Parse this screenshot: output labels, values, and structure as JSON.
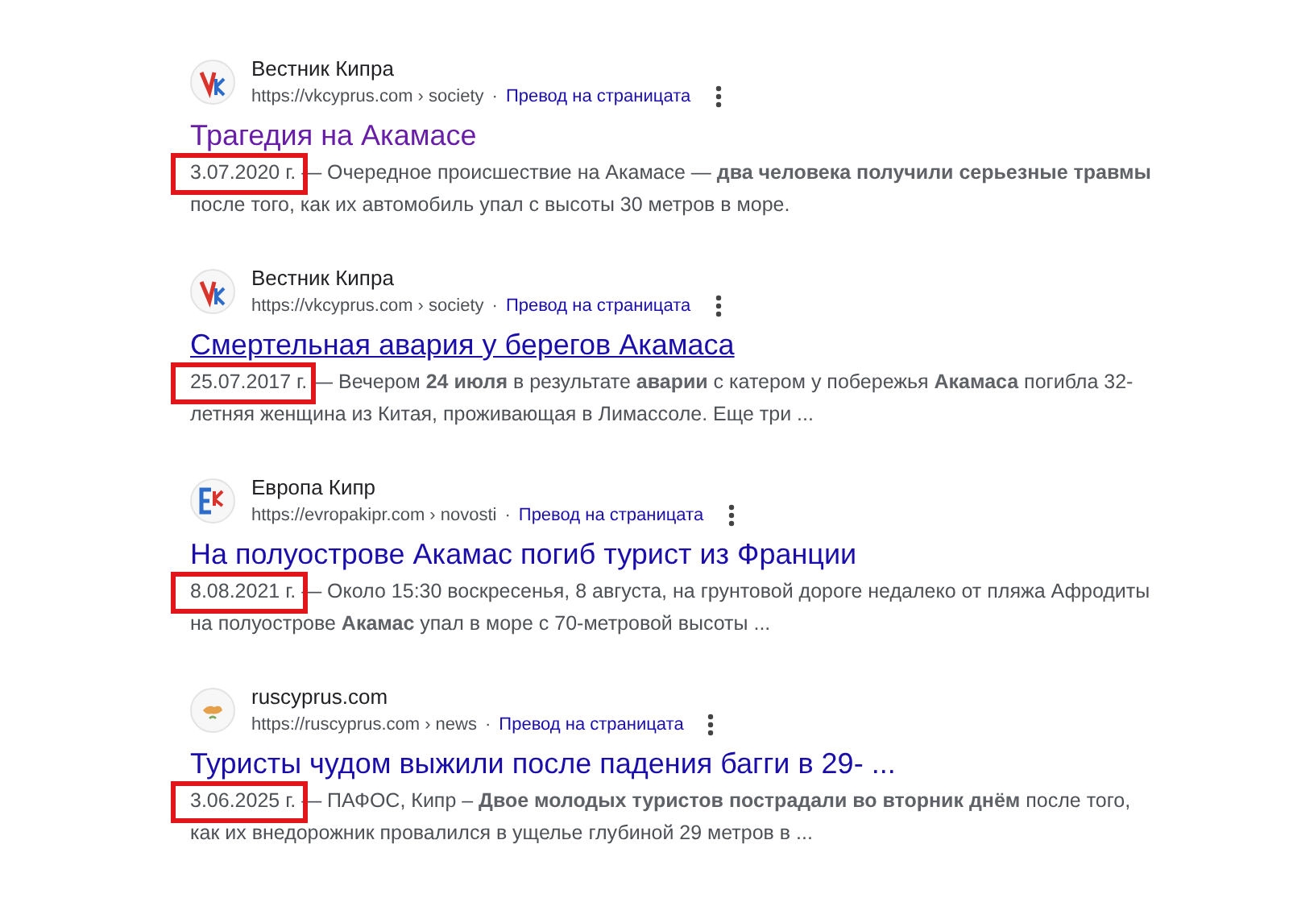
{
  "results": [
    {
      "site": "Вестник Кипра",
      "url": "https://vkcyprus.com",
      "path": "› society",
      "separator": "·",
      "translate": "Превод на страницата",
      "kind": "vk",
      "title": "Трагедия на Акамасе",
      "visited": true,
      "underlined": false,
      "date": "3.07.2020 г.",
      "highlighted": true,
      "snippet": "— Очередное происшествие на Акамасе — **два человека получили серьезные травмы** после того, как их автомобиль упал с высоты 30 метров в море."
    },
    {
      "site": "Вестник Кипра",
      "url": "https://vkcyprus.com",
      "path": "› society",
      "separator": "·",
      "translate": "Превод на страницата",
      "kind": "vk",
      "title": "Смертельная авария у берегов Акамаса",
      "visited": false,
      "underlined": true,
      "date": "25.07.2017 г.",
      "highlighted": true,
      "snippet": "— Вечером **24 июля** в результате **аварии** с катером у побережья **Акамаса** погибла 32-летняя женщина из Китая, проживающая в Лимассоле. Еще три ..."
    },
    {
      "site": "Европа Кипр",
      "url": "https://evropakipr.com",
      "path": "› novosti",
      "separator": "·",
      "translate": "Превод на страницата",
      "kind": "ek",
      "title": "На полуострове Акамас погиб турист из Франции",
      "visited": false,
      "underlined": false,
      "date": "8.08.2021 г.",
      "highlighted": true,
      "snippet": "— Около 15:30 воскресенья, 8 августа, на грунтовой дороге недалеко от пляжа Афродиты на полуострове **Акамас** упал в море с 70-метровой высоты ..."
    },
    {
      "site": "ruscyprus.com",
      "url": "https://ruscyprus.com",
      "path": "› news",
      "separator": "·",
      "translate": "Превод на страницата",
      "kind": "rc",
      "title": "Туристы чудом выжили после падения багги в 29- ...",
      "visited": false,
      "underlined": false,
      "date": "3.06.2025 г.",
      "highlighted": true,
      "snippet": "— ПАФОС, Кипр – **Двое молодых туристов пострадали во вторник днём** после того, как их внедорожник провалился в ущелье глубиной 29 метров в ..."
    }
  ]
}
